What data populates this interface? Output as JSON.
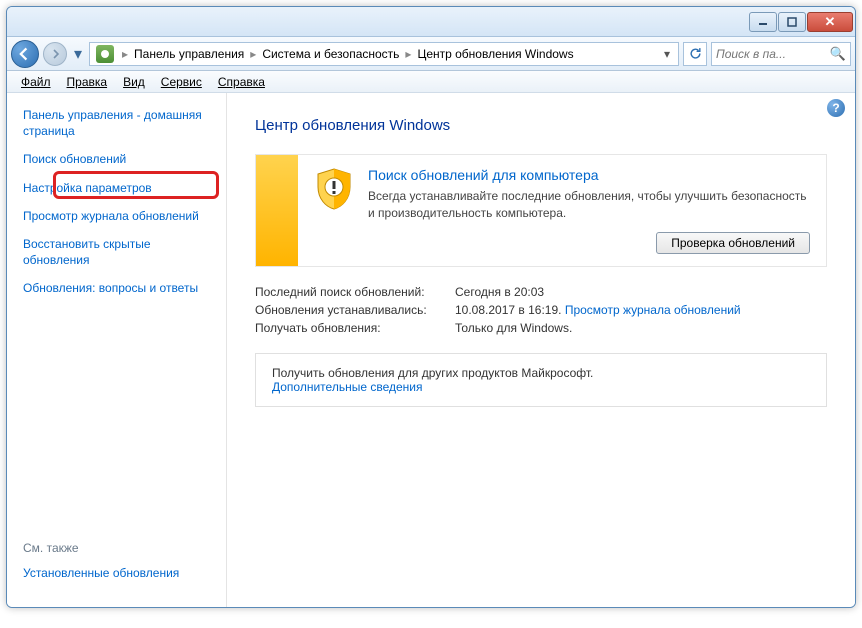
{
  "titlebar": {},
  "breadcrumb": {
    "items": [
      "Панель управления",
      "Система и безопасность",
      "Центр обновления Windows"
    ]
  },
  "search": {
    "placeholder": "Поиск в па..."
  },
  "menubar": {
    "file": "Файл",
    "edit": "Правка",
    "view": "Вид",
    "tools": "Сервис",
    "help": "Справка"
  },
  "sidebar": {
    "home": "Панель управления - домашняя страница",
    "check": "Поиск обновлений",
    "settings": "Настройка параметров",
    "history": "Просмотр журнала обновлений",
    "restore": "Восстановить скрытые обновления",
    "faq": "Обновления: вопросы и ответы",
    "see_also": "См. также",
    "installed": "Установленные обновления"
  },
  "main": {
    "title": "Центр обновления Windows",
    "panel": {
      "heading": "Поиск обновлений для компьютера",
      "desc": "Всегда устанавливайте последние обновления, чтобы улучшить безопасность и производительность компьютера.",
      "check_btn": "Проверка обновлений"
    },
    "info": {
      "last_check_label": "Последний поиск обновлений:",
      "last_check_value": "Сегодня в 20:03",
      "installed_label": "Обновления устанавливались:",
      "installed_value": "10.08.2017 в 16:19.",
      "installed_link": "Просмотр журнала обновлений",
      "receive_label": "Получать обновления:",
      "receive_value": "Только для Windows."
    },
    "other": {
      "text": "Получить обновления для других продуктов Майкрософт.",
      "link": "Дополнительные сведения"
    }
  }
}
